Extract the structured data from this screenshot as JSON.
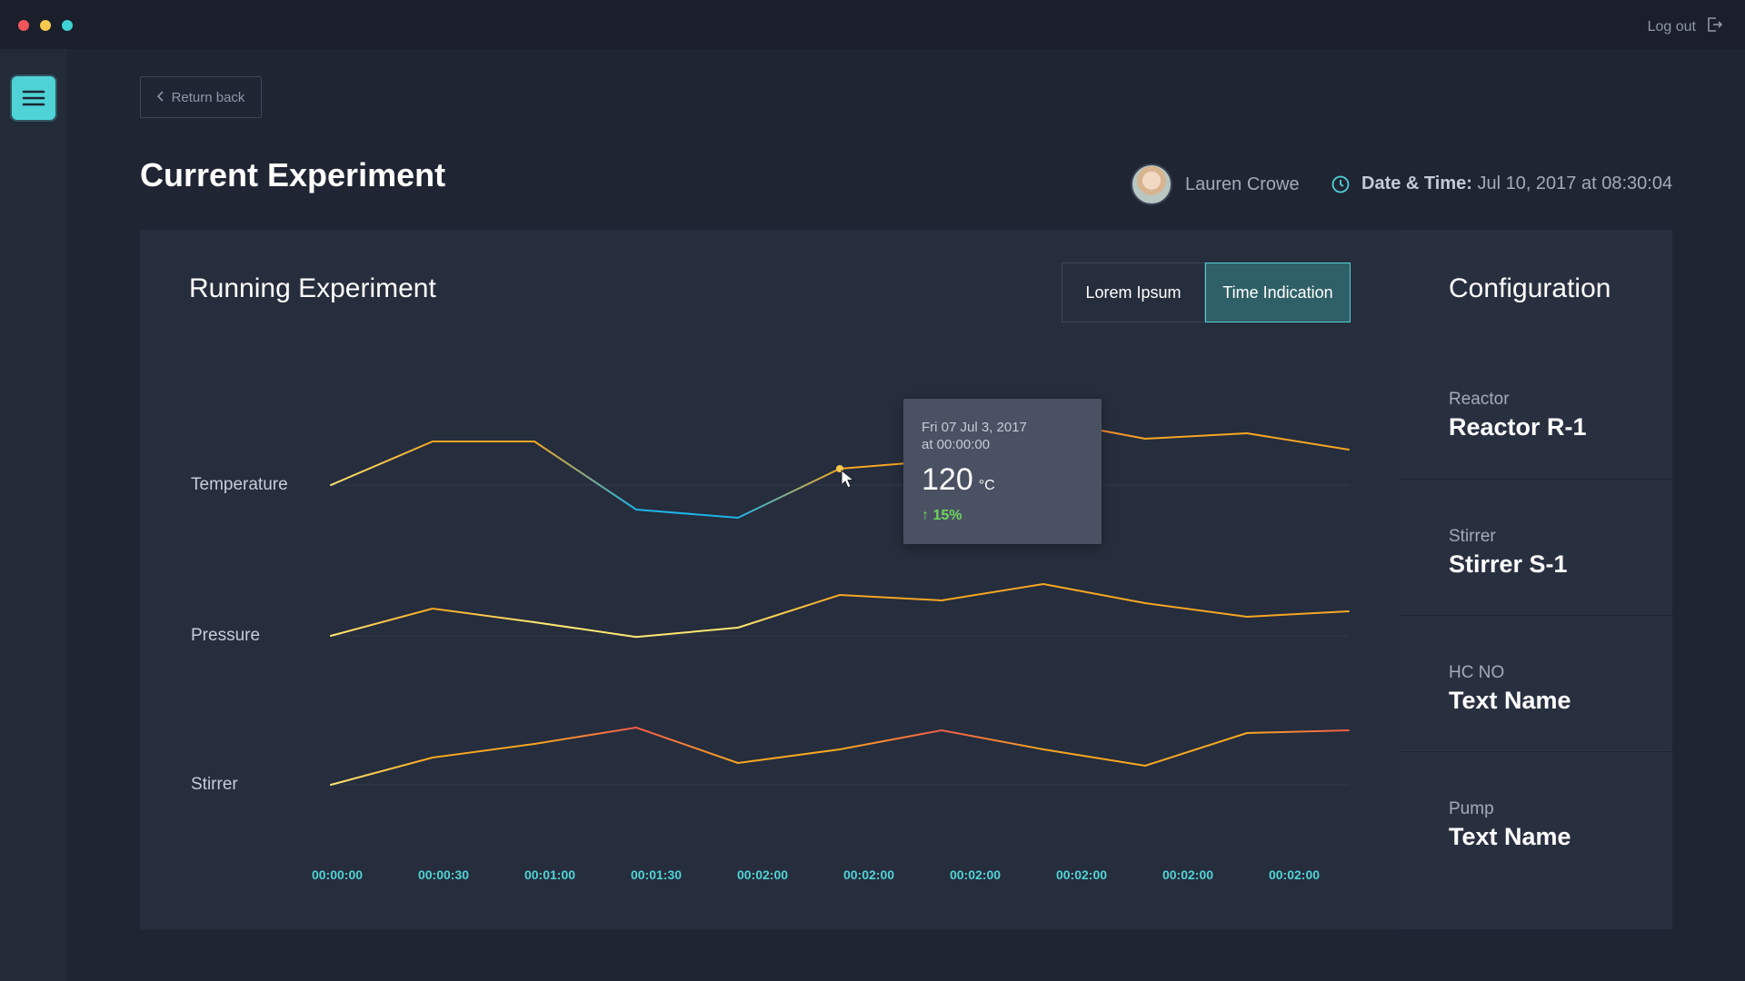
{
  "titlebar": {
    "logout_label": "Log out"
  },
  "nav": {
    "return_label": "Return back"
  },
  "header": {
    "title": "Current Experiment",
    "user_name": "Lauren Crowe",
    "datetime_label": "Date & Time:",
    "datetime_value": "Jul 10, 2017 at 08:30:04"
  },
  "experiment": {
    "title": "Running Experiment",
    "toggle": {
      "option_1": "Lorem Ipsum",
      "option_2": "Time Indication",
      "active": "Time Indication"
    }
  },
  "tooltip": {
    "date_line_1": "Fri 07 Jul 3, 2017",
    "date_line_2": "at 00:00:00",
    "value": "120",
    "unit": "°C",
    "change": "15%"
  },
  "configuration": {
    "title": "Configuration",
    "items": [
      {
        "label": "Reactor",
        "value": "Reactor R-1"
      },
      {
        "label": "Stirrer",
        "value": "Stirrer S-1"
      },
      {
        "label": "HC NO",
        "value": "Text Name"
      },
      {
        "label": "Pump",
        "value": "Text Name"
      }
    ]
  },
  "chart_data": {
    "type": "line",
    "x": [
      "00:00:00",
      "00:00:30",
      "00:01:00",
      "00:01:30",
      "00:02:00",
      "00:02:00",
      "00:02:00",
      "00:02:00",
      "00:02:00",
      "00:02:00"
    ],
    "series": [
      {
        "name": "Temperature",
        "values": [
          0,
          0.8,
          0.8,
          -0.45,
          -0.6,
          0.3,
          0.45,
          1.2,
          0.85,
          0.95,
          0.65
        ]
      },
      {
        "name": "Pressure",
        "values": [
          0,
          0.5,
          0.25,
          -0.02,
          0.15,
          0.75,
          0.65,
          0.95,
          0.6,
          0.35,
          0.45
        ]
      },
      {
        "name": "Stirrer",
        "values": [
          0,
          0.5,
          0.75,
          1.05,
          0.4,
          0.65,
          1.0,
          0.65,
          0.35,
          0.95,
          1.0
        ]
      }
    ],
    "highlight": {
      "series": "Temperature",
      "index": 5
    },
    "colors": {
      "low": "#1eb3e8",
      "mid": "#ffe873",
      "high": "#f5a623",
      "peak": "#ef5b4a",
      "grid": "#333b4b",
      "xtick": "#4fd3d6"
    }
  }
}
